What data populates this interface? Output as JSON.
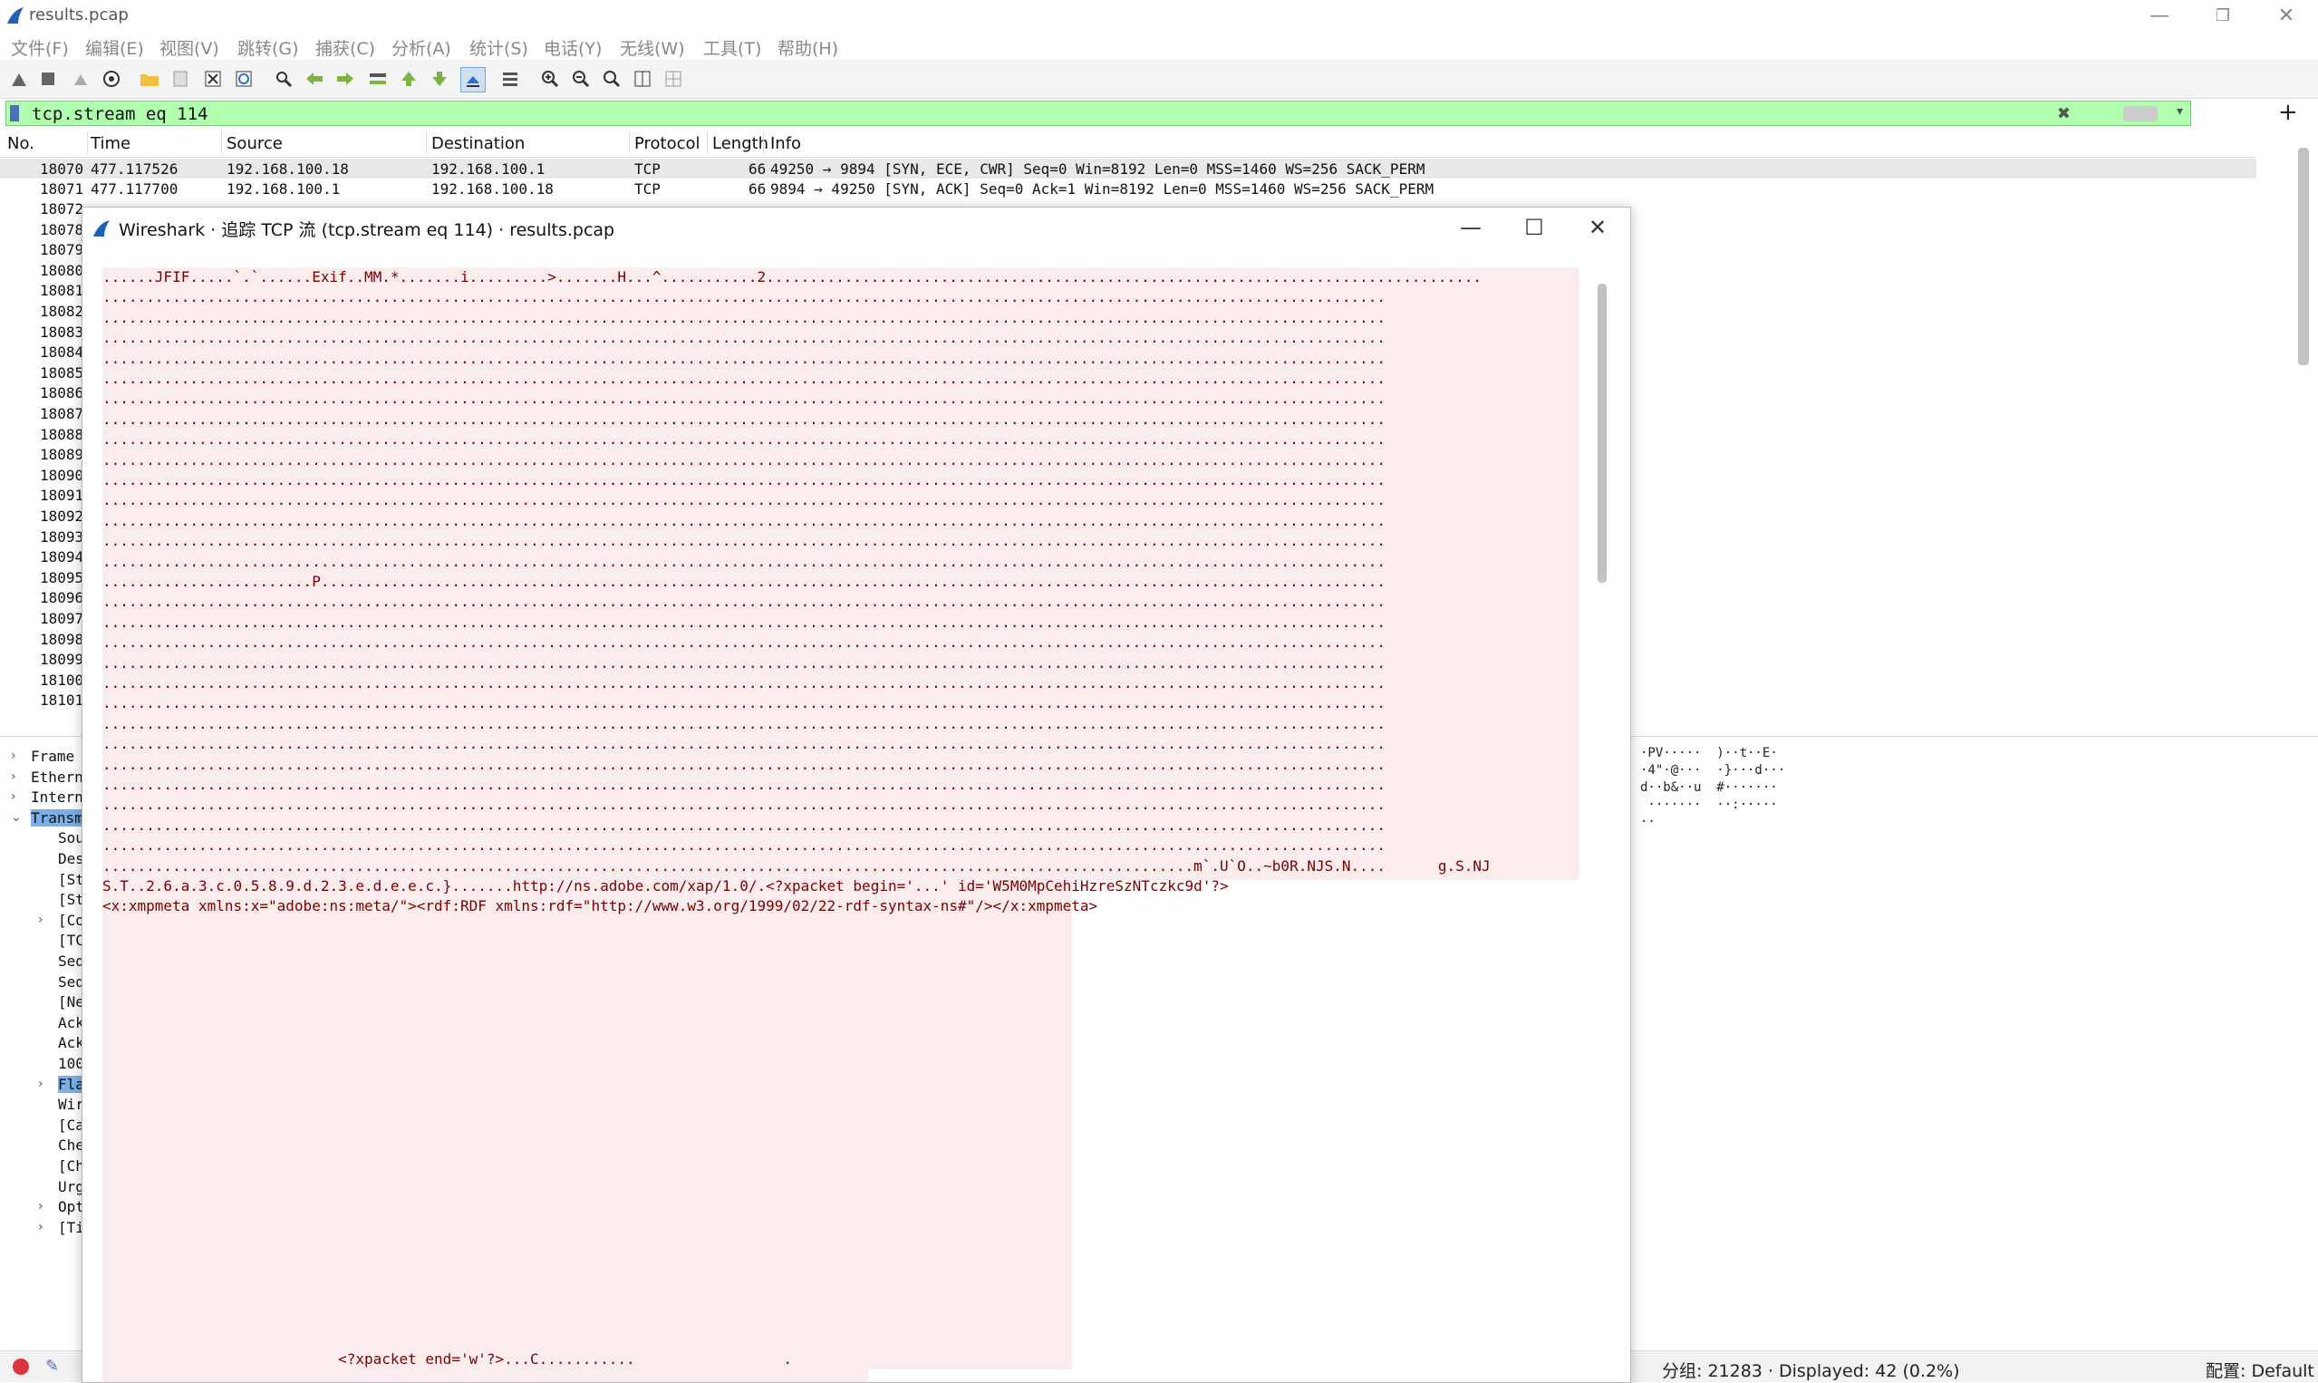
{
  "window": {
    "title": "results.pcap",
    "minimize": "—",
    "restore": "❐",
    "close": "✕"
  },
  "menu": [
    "文件(F)",
    "编辑(E)",
    "视图(V)",
    "跳转(G)",
    "捕获(C)",
    "分析(A)",
    "统计(S)",
    "电话(Y)",
    "无线(W)",
    "工具(T)",
    "帮助(H)"
  ],
  "filter": {
    "value": "tcp.stream eq 114",
    "clear_icon": "✖",
    "plus": "+",
    "drop": "▾"
  },
  "packet_list": {
    "columns": [
      "No.",
      "Time",
      "Source",
      "Destination",
      "Protocol",
      "Length",
      "Info"
    ],
    "rows": [
      {
        "no": "18070",
        "time": "477.117526",
        "src": "192.168.100.18",
        "dst": "192.168.100.1",
        "proto": "TCP",
        "len": "66",
        "info": "49250 → 9894 [SYN, ECE, CWR] Seq=0 Win=8192 Len=0 MSS=1460 WS=256 SACK_PERM"
      },
      {
        "no": "18071",
        "time": "477.117700",
        "src": "192.168.100.1",
        "dst": "192.168.100.18",
        "proto": "TCP",
        "len": "66",
        "info": "9894 → 49250 [SYN, ACK] Seq=0 Ack=1 Win=8192 Len=0 MSS=1460 WS=256 SACK_PERM"
      }
    ],
    "more_numbers": [
      "18072",
      "18078",
      "18079",
      "18080",
      "18081",
      "18082",
      "18083",
      "18084",
      "18085",
      "18086",
      "18087",
      "18088",
      "18089",
      "18090",
      "18091",
      "18092",
      "18093",
      "18094",
      "18095",
      "18096",
      "18097",
      "18098",
      "18099",
      "18100",
      "18101"
    ]
  },
  "details": {
    "items": [
      {
        "label": "Frame",
        "level": 0,
        "chev": ">",
        "hl": false
      },
      {
        "label": "Ethern",
        "level": 0,
        "chev": ">",
        "hl": false
      },
      {
        "label": "Intern",
        "level": 0,
        "chev": ">",
        "hl": false
      },
      {
        "label": "Transm",
        "level": 0,
        "chev": "v",
        "hl": true
      },
      {
        "label": "Sou",
        "level": 1,
        "chev": "",
        "hl": false
      },
      {
        "label": "Des",
        "level": 1,
        "chev": "",
        "hl": false
      },
      {
        "label": "[St",
        "level": 1,
        "chev": "",
        "hl": false
      },
      {
        "label": "[St",
        "level": 1,
        "chev": "",
        "hl": false
      },
      {
        "label": "[Co",
        "level": 1,
        "chev": ">",
        "hl": false
      },
      {
        "label": "[TC",
        "level": 1,
        "chev": "",
        "hl": false
      },
      {
        "label": "Seq",
        "level": 1,
        "chev": "",
        "hl": false
      },
      {
        "label": "Seq",
        "level": 1,
        "chev": "",
        "hl": false
      },
      {
        "label": "[Ne",
        "level": 1,
        "chev": "",
        "hl": false
      },
      {
        "label": "Ack",
        "level": 1,
        "chev": "",
        "hl": false
      },
      {
        "label": "Ack",
        "level": 1,
        "chev": "",
        "hl": false
      },
      {
        "label": "100",
        "level": 1,
        "chev": "",
        "hl": false
      },
      {
        "label": "Fla",
        "level": 1,
        "chev": ">",
        "hl": true
      },
      {
        "label": "Wir",
        "level": 1,
        "chev": "",
        "hl": false
      },
      {
        "label": "[Ca",
        "level": 1,
        "chev": "",
        "hl": false
      },
      {
        "label": "Che",
        "level": 1,
        "chev": "",
        "hl": false
      },
      {
        "label": "[Ch",
        "level": 1,
        "chev": "",
        "hl": false
      },
      {
        "label": "Urg",
        "level": 1,
        "chev": "",
        "hl": false
      },
      {
        "label": "Opt",
        "level": 1,
        "chev": ">",
        "hl": false
      },
      {
        "label": "[Ti",
        "level": 1,
        "chev": ">",
        "hl": false
      }
    ],
    "bytes": [
      "·PV·····  )··t··E·",
      "·4\"·@···  ·}···d···",
      "d··b&··u  #·······",
      " ·······  ··:·····",
      "··"
    ]
  },
  "status": {
    "packets": "分组: 21283 · Displayed: 42 (0.2%)",
    "profile": "配置: Default"
  },
  "dialog": {
    "title": "Wireshark · 追踪 TCP 流 (tcp.stream eq 114) · results.pcap",
    "minimize": "—",
    "maximize": "☐",
    "close": "✕",
    "stream_lines": [
      "......JFIF.....`.`......Exif..MM.*.......i.........>.......H...^...........2..................................................................................",
      "...................................................................................................................................................",
      "...................................................................................................................................................",
      "...................................................................................................................................................",
      "...................................................................................................................................................",
      "...................................................................................................................................................",
      "...................................................................................................................................................",
      "...................................................................................................................................................",
      "...................................................................................................................................................",
      "...................................................................................................................................................",
      "...................................................................................................................................................",
      "...................................................................................................................................................",
      "...................................................................................................................................................",
      "...................................................................................................................................................",
      "...................................................................................................................................................",
      "........................P..........................................................................................................................",
      "...................................................................................................................................................",
      "...................................................................................................................................................",
      "...................................................................................................................................................",
      "...................................................................................................................................................",
      "...................................................................................................................................................",
      "...................................................................................................................................................",
      "...................................................................................................................................................",
      "...................................................................................................................................................",
      "...................................................................................................................................................",
      "...................................................................................................................................................",
      "...................................................................................................................................................",
      "...................................................................................................................................................",
      "...................................................................................................................................................",
      ".............................................................................................................................m`.U`O..~b0R.NJS.N....      g.S.NJ",
      "S.T..2.6.a.3.c.0.5.8.9.d.2.3.e.d.e.e.c.}.......http://ns.adobe.com/xap/1.0/.<?xpacket begin='...' id='W5M0MpCehiHzreSzNTczkc9d'?>",
      "<x:xmpmeta xmlns:x=\"adobe:ns:meta/\"><rdf:RDF xmlns:rdf=\"http://www.w3.org/1999/02/22-rdf-syntax-ns#\"/></x:xmpmeta>"
    ],
    "tail_line": "                           <?xpacket end='w'?>...C...........                 ."
  }
}
